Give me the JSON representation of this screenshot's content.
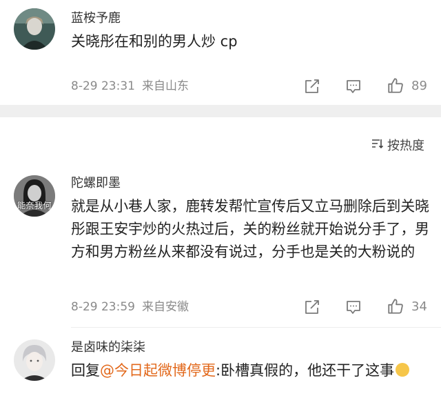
{
  "comments": [
    {
      "username": "蓝桉予鹿",
      "text": "关晓彤在和别的男人炒 cp",
      "date": "8-29 23:31",
      "location": "来自山东",
      "likes": "89"
    },
    {
      "username": "陀螺即墨",
      "avatar_caption": "能奈我何",
      "text": "就是从小巷人家，鹿转发帮忙宣传后又立马删除后到关晓彤跟王安宇炒的火热过后，关的粉丝就开始说分手了，男方和男方粉丝从来都没有说过，分手也是关的大粉说的",
      "date": "8-29 23:59",
      "location": "来自安徽",
      "likes": "34"
    },
    {
      "username": "是卤味的柒柒",
      "reply_prefix": "回复",
      "mention": "@今日起微博停更",
      "text": ":卧槽真假的，他还干了这事"
    }
  ],
  "sort": {
    "label": "按热度"
  },
  "icons": [
    "share-icon",
    "comment-icon",
    "like-icon",
    "sort-icon",
    "emoji-sweat-icon"
  ]
}
